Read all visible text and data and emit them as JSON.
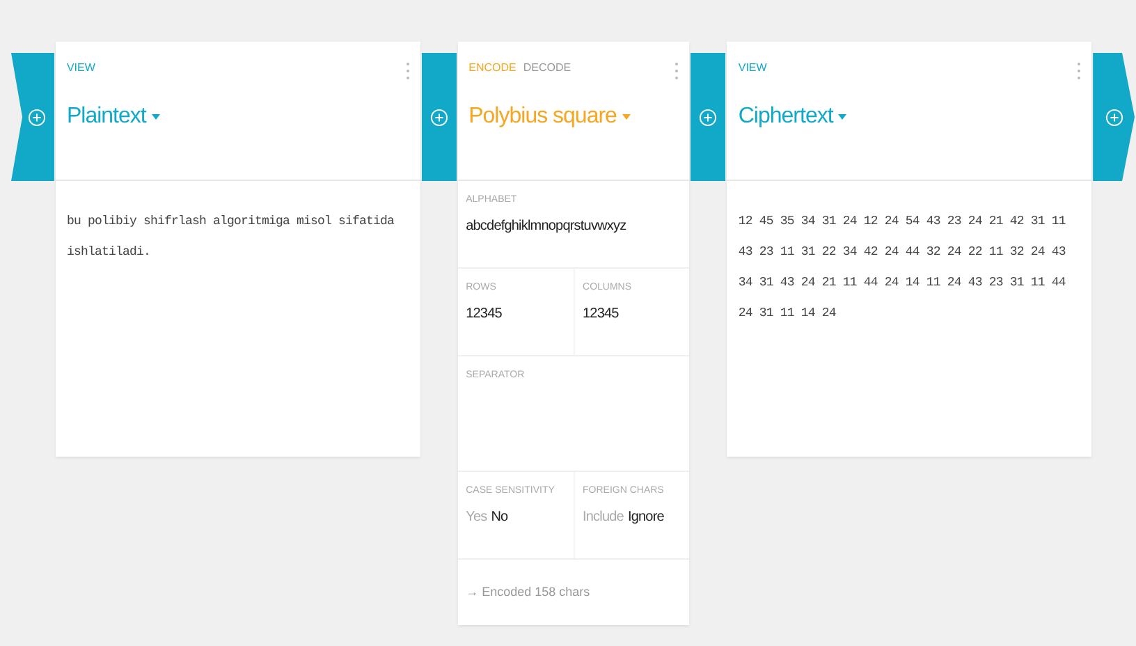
{
  "cards": [
    {
      "kind": "view",
      "tabs": [
        {
          "label": "VIEW",
          "selected": true
        }
      ],
      "title": "Plaintext",
      "text": "bu polibiy shifrlash algoritmiga misol sifatida ishlatiladi."
    },
    {
      "kind": "operation",
      "tabs": [
        {
          "label": "ENCODE",
          "selected": true
        },
        {
          "label": "DECODE",
          "selected": false
        }
      ],
      "title": "Polybius square",
      "settings": [
        [
          {
            "kind": "text",
            "label": "ALPHABET",
            "value": "abcdefghiklmnopqrstuvwxyz"
          }
        ],
        [
          {
            "kind": "text",
            "label": "ROWS",
            "value": "12345"
          },
          {
            "kind": "text",
            "label": "COLUMNS",
            "value": "12345"
          }
        ],
        [
          {
            "kind": "text",
            "label": "SEPARATOR"
          }
        ],
        [
          {
            "kind": "choice",
            "label": "CASE SENSITIVITY",
            "options": [
              {
                "label": "Yes",
                "selected": false
              },
              {
                "label": "No",
                "selected": true
              }
            ]
          },
          {
            "kind": "choice",
            "label": "FOREIGN CHARS",
            "options": [
              {
                "label": "Include",
                "selected": false
              },
              {
                "label": "Ignore",
                "selected": true
              }
            ]
          }
        ]
      ],
      "status": "→ Encoded 158 chars"
    },
    {
      "kind": "view",
      "tabs": [
        {
          "label": "VIEW",
          "selected": true
        }
      ],
      "title": "Ciphertext",
      "text": "12 45 35 34 31 24 12 24 54 43 23 24 21 42 31 11 43 23 11 31 22 34 42 24 44 32 24 22 11 32 24 43 34 31 43 24 21 11 44 24 14 11 24 43 23 31 11 44 24 31 11 14 24"
    }
  ]
}
